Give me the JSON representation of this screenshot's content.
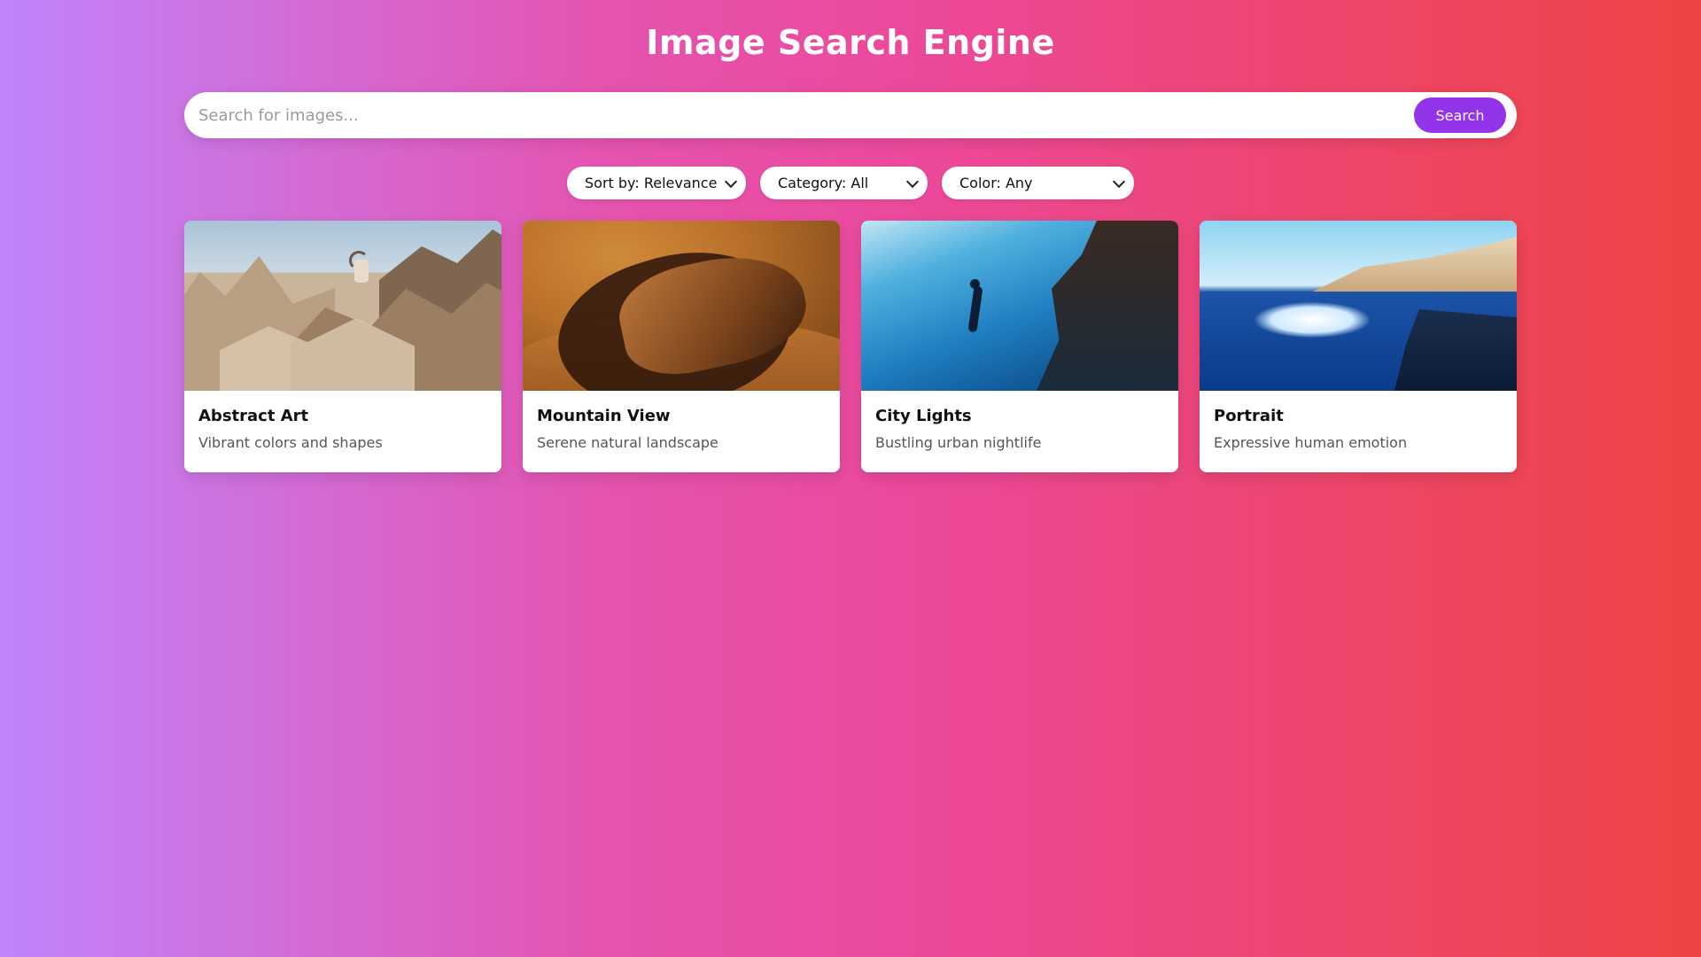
{
  "header": {
    "title": "Image Search Engine"
  },
  "search": {
    "placeholder": "Search for images...",
    "value": "",
    "button_label": "Search"
  },
  "filters": {
    "sort": "Sort by: Relevance",
    "category": "Category: All",
    "color": "Color: Any"
  },
  "colors": {
    "accent": "#9333ea",
    "gradient_start": "#c084fc",
    "gradient_mid": "#ec4899",
    "gradient_end": "#ef4444"
  },
  "results": [
    {
      "title": "Abstract Art",
      "description": "Vibrant colors and shapes"
    },
    {
      "title": "Mountain View",
      "description": "Serene natural landscape"
    },
    {
      "title": "City Lights",
      "description": "Bustling urban nightlife"
    },
    {
      "title": "Portrait",
      "description": "Expressive human emotion"
    }
  ]
}
